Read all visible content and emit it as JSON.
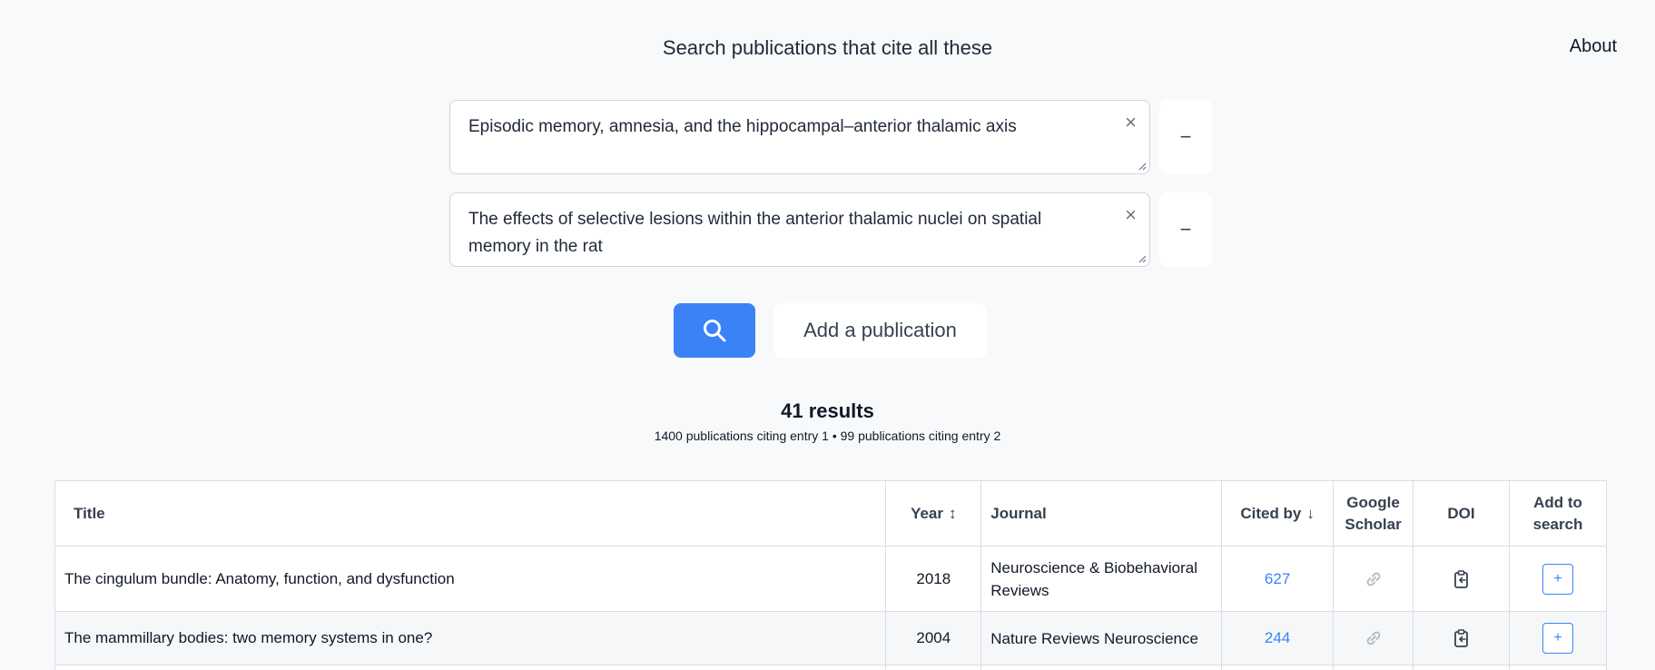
{
  "header": {
    "title": "Search publications that cite all these",
    "about_label": "About"
  },
  "entries": [
    {
      "text": "Episodic memory, amnesia, and the hippocampal–anterior thalamic axis",
      "clear_label": "×",
      "remove_label": "−"
    },
    {
      "text": "The effects of selective lesions within the anterior thalamic nuclei on spatial memory in the rat",
      "clear_label": "×",
      "remove_label": "−"
    }
  ],
  "actions": {
    "search_icon": "search-icon",
    "add_publication_label": "Add a publication"
  },
  "results": {
    "count_label": "41 results",
    "summary": "1400 publications citing entry 1 • 99 publications citing entry 2"
  },
  "table": {
    "headers": {
      "title": "Title",
      "year": "Year",
      "year_sort": "↕",
      "journal": "Journal",
      "cited_by": "Cited by",
      "cited_by_sort": "↓",
      "scholar_line1": "Google",
      "scholar_line2": "Scholar",
      "doi": "DOI",
      "add_line1": "Add to",
      "add_line2": "search"
    },
    "rows": [
      {
        "title": "The cingulum bundle: Anatomy, function, and dysfunction",
        "year": "2018",
        "journal": "Neuroscience & Biobehavioral Reviews",
        "cited_by": "627",
        "scholar_icon": "link-icon",
        "doi_icon": "clipboard-icon",
        "add_label": "+"
      },
      {
        "title": "The mammillary bodies: two memory systems in one?",
        "year": "2004",
        "journal": "Nature Reviews Neuroscience",
        "cited_by": "244",
        "scholar_icon": "link-icon",
        "doi_icon": "clipboard-icon",
        "add_label": "+"
      }
    ]
  },
  "colors": {
    "accent": "#3b82f6",
    "background": "#f8f9fb",
    "border": "#d9dde3"
  }
}
